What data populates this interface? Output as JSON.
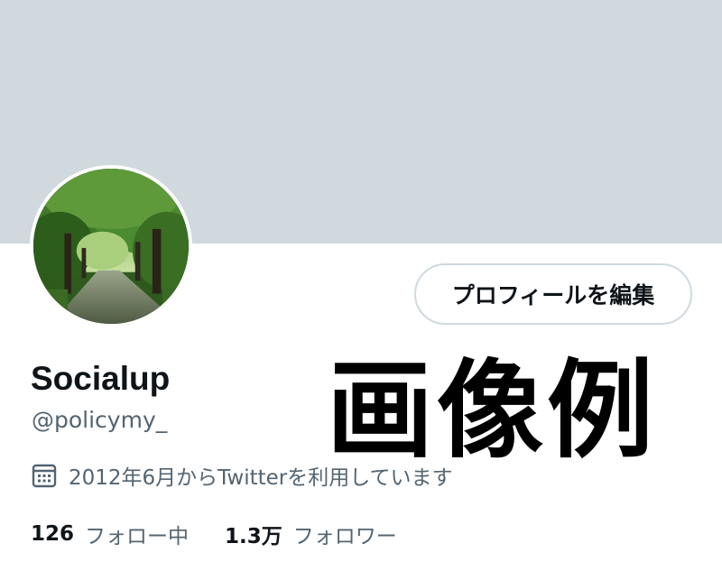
{
  "profile": {
    "display_name": "Socialup",
    "handle": "@policymy_",
    "edit_button_label": "プロフィールを編集",
    "joined_text": "2012年6月からTwitterを利用しています",
    "following_count": "126",
    "following_label": "フォロー中",
    "followers_count": "1.3万",
    "followers_label": "フォロワー"
  },
  "overlay": {
    "watermark_text": "画像例"
  },
  "icons": {
    "joined": "calendar-icon"
  },
  "colors": {
    "banner": "#cfd9de",
    "primary_text": "#0f1419",
    "secondary_text": "#536471",
    "button_border": "#cfd9de"
  }
}
